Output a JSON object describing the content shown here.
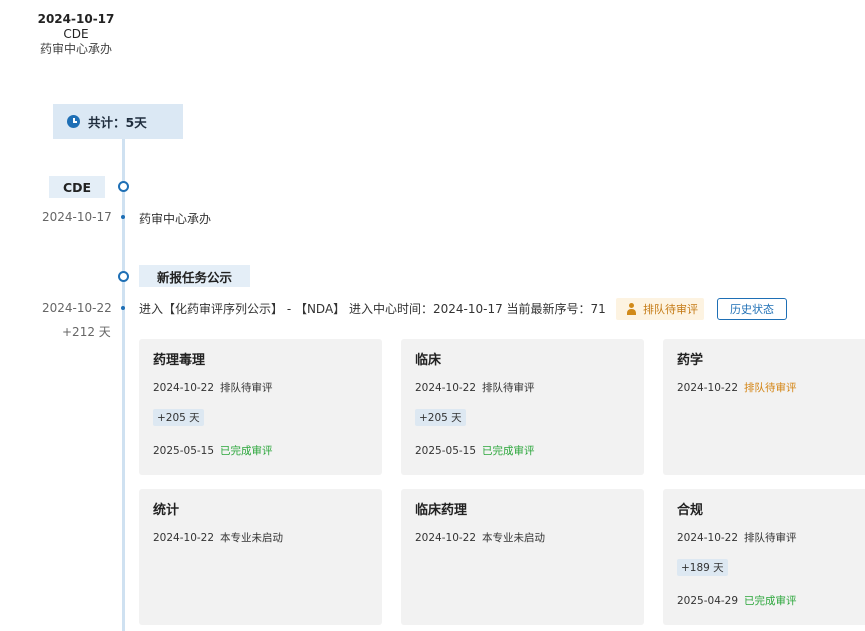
{
  "header": {
    "date": "2024-10-17",
    "org": "CDE",
    "org_desc": "药审中心承办"
  },
  "total": {
    "label": "共计：5天"
  },
  "colors": {
    "accent": "#1e6fb5",
    "chip_bg": "#e4eef7",
    "card_bg": "#f2f2f2",
    "pending": "#d48412",
    "done": "#2aa63a"
  },
  "stages": [
    {
      "title": "CDE",
      "date": "2024-10-17",
      "text": "药审中心承办"
    },
    {
      "title": "新报任务公示",
      "date": "2024-10-22",
      "delta": "+212 天",
      "text": "进入【化药审评序列公示】 - 【NDA】 进入中心时间：2024-10-17 当前最新序号：71",
      "badge": "排队待审评",
      "button": "历史状态"
    }
  ],
  "cards": [
    {
      "title": "药理毒理",
      "start_date": "2024-10-22",
      "start_status": "排队待审评",
      "days": "+205 天",
      "end_date": "2025-05-15",
      "end_status": "已完成审评"
    },
    {
      "title": "临床",
      "start_date": "2024-10-22",
      "start_status": "排队待审评",
      "days": "+205 天",
      "end_date": "2025-05-15",
      "end_status": "已完成审评"
    },
    {
      "title": "药学",
      "start_date": "2024-10-22",
      "start_status": "排队待审评"
    },
    {
      "title": "统计",
      "start_date": "2024-10-22",
      "start_status": "本专业未启动"
    },
    {
      "title": "临床药理",
      "start_date": "2024-10-22",
      "start_status": "本专业未启动"
    },
    {
      "title": "合规",
      "start_date": "2024-10-22",
      "start_status": "排队待审评",
      "days": "+189 天",
      "end_date": "2025-04-29",
      "end_status": "已完成审评"
    }
  ],
  "icons": {
    "total": "clock-icon",
    "badge": "person-icon"
  }
}
